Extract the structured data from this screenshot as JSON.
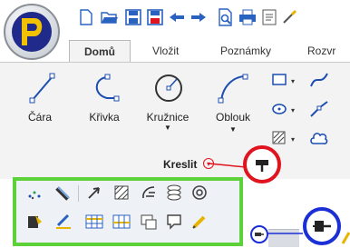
{
  "tabs": [
    {
      "label": "Domů",
      "active": true
    },
    {
      "label": "Vložit",
      "active": false
    },
    {
      "label": "Poznámky",
      "active": false
    },
    {
      "label": "Rozvr",
      "active": false
    }
  ],
  "kreslit_group": {
    "title": "Kreslit",
    "buttons": [
      {
        "label": "Čára",
        "icon": "line-icon"
      },
      {
        "label": "Křivka",
        "icon": "curve-icon"
      },
      {
        "label": "Kružnice",
        "icon": "circle-icon"
      },
      {
        "label": "Oblouk",
        "icon": "arc-icon"
      }
    ],
    "small_buttons": [
      "rectangle-icon",
      "spline-icon",
      "ellipse-icon",
      "polyline-icon",
      "hatch-icon",
      "cloud-icon"
    ]
  },
  "toolbar_icons_row1": [
    "dots-icon",
    "ruler-icon",
    "arrow-icon",
    "hatch-pattern-icon",
    "edit-curve-icon",
    "layers-icon",
    "target-icon"
  ],
  "toolbar_icons_row2": [
    "paint-icon",
    "pen-icon",
    "table-icon",
    "grid-icon",
    "window-icon",
    "frame-icon",
    "pencil-icon"
  ],
  "colors": {
    "green_highlight": "#5cd13a",
    "red_callout": "#e0141e",
    "blue_callout": "#1a2fd6",
    "ribbon_bg": "#f3f3f3"
  }
}
